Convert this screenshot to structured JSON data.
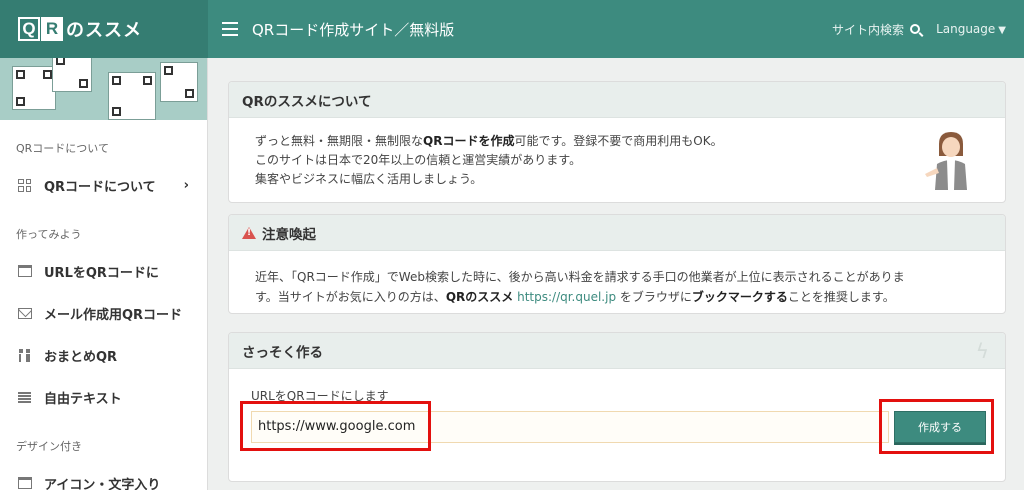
{
  "header": {
    "logo_q": "Q",
    "logo_r": "R",
    "logo_text": "のススメ",
    "site_title": "QRコード作成サイト／無料版",
    "search_label": "サイト内検索",
    "language_label": "Language",
    "language_caret": "▼"
  },
  "sidebar": {
    "sections": [
      {
        "title": "QRコードについて"
      },
      {
        "title": "作ってみよう"
      },
      {
        "title": "デザイン付き"
      }
    ],
    "items": [
      {
        "label": "QRコードについて",
        "chevron": "›"
      },
      {
        "label": "URLをQRコードに"
      },
      {
        "label": "メール作成用QRコード"
      },
      {
        "label": "おまとめQR"
      },
      {
        "label": "自由テキスト"
      },
      {
        "label": "アイコン・文字入り"
      }
    ]
  },
  "about": {
    "title": "QRのススメについて",
    "line1_a": "ずっと無料・無期限・無制限な",
    "line1_b": "QRコードを作成",
    "line1_c": "可能です。登録不要で商用利用もOK。",
    "line2": "このサイトは日本で20年以上の信頼と運営実績があります。",
    "line3": "集客やビジネスに幅広く活用しましょう。"
  },
  "warning": {
    "title": "注意喚起",
    "line1": "近年、「QRコード作成」でWeb検索した時に、後から高い料金を請求する手口の他業者が上位に表示されることがありま",
    "line2_a": "す。当サイトがお気に入りの方は、",
    "line2_b": "QRのススメ",
    "line2_c": " ",
    "line2_link": "https://qr.quel.jp",
    "line2_d": " をブラウザに",
    "line2_e": "ブックマークする",
    "line2_f": "ことを推奨します。"
  },
  "quick": {
    "title": "さっそく作る",
    "bolt": "ϟ",
    "url_label": "URLをQRコードにします",
    "url_value": "https://www.google.com",
    "create_label": "作成する"
  },
  "colors": {
    "brand": "#3d8b7f",
    "highlight": "#e3100e",
    "warning": "#d9534f"
  }
}
